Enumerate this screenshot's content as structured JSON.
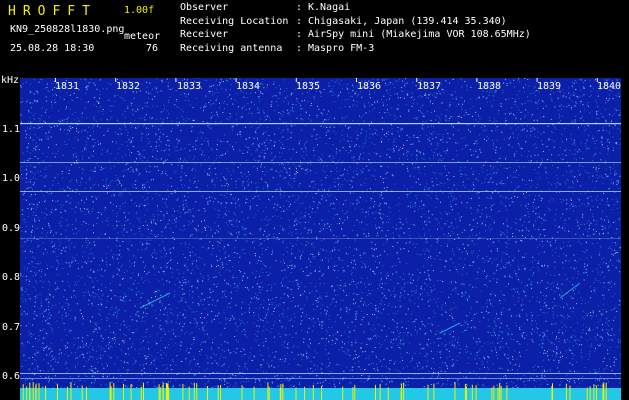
{
  "header": {
    "app_name": "HROFFT",
    "version": "1.00f",
    "filename": "KN9_250828l1830.png",
    "mode": "meteor",
    "datetime": "25.08.28 18:30",
    "count": "76"
  },
  "info": [
    {
      "label": "Observer",
      "value": "K.Nagai"
    },
    {
      "label": "Receiving Location",
      "value": "Chigasaki, Japan (139.414 35.340)"
    },
    {
      "label": "Receiver",
      "value": "AirSpy mini (Miakejima VOR 108.65MHz)"
    },
    {
      "label": "Receiving antenna",
      "value": "Maspro FM-3"
    }
  ],
  "spectrogram": {
    "y_unit": "kHz",
    "y_ticks": [
      "1.1",
      "1.0",
      "0.9",
      "0.8",
      "0.7",
      "0.6"
    ],
    "x_ticks": [
      "1831",
      "1832",
      "1833",
      "1834",
      "1835",
      "1836",
      "1837",
      "1838",
      "1839",
      "1840"
    ],
    "colors": {
      "background": "#0b1fa8",
      "noise": "#22c8e6",
      "signal": "#f0f000",
      "line": "#bfe8ff"
    }
  }
}
